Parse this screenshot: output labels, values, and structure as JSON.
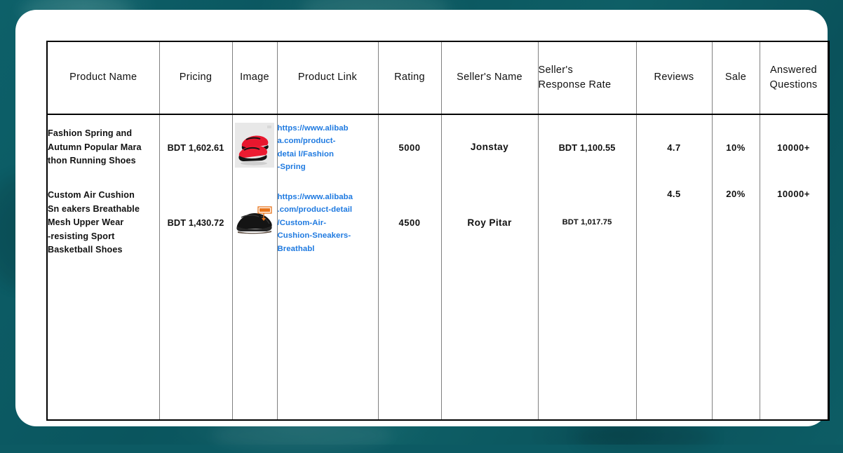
{
  "theme": {
    "background_color": "#0c5a63",
    "card_color": "#ffffff",
    "table_border_color": "#000000",
    "grid_line_color": "#808080",
    "link_color": "#1f7ae0",
    "text_color": "#111111"
  },
  "table": {
    "columns": [
      {
        "key": "product_name",
        "label": "Product Name"
      },
      {
        "key": "pricing",
        "label": "Pricing"
      },
      {
        "key": "image",
        "label": "Image"
      },
      {
        "key": "product_link",
        "label": "Product Link"
      },
      {
        "key": "rating",
        "label": "Rating"
      },
      {
        "key": "sellers_name",
        "label": "Seller's Name"
      },
      {
        "key": "sellers_response_rate",
        "label": "Seller's\nResponse Rate"
      },
      {
        "key": "reviews",
        "label": "Reviews"
      },
      {
        "key": "sale",
        "label": "Sale"
      },
      {
        "key": "answered_questions",
        "label": "Answered\nQuestions"
      }
    ],
    "rows": [
      {
        "product_name": "Fashion Spring and\nAutumn Popular Mara\nthon Running Shoes",
        "pricing": "BDT 1,602.61",
        "image_alt": "red-running-shoes-thumbnail",
        "product_link": "https://www.alibab\na.com/product-\ndetai l/Fashion\n-Spring",
        "rating": "5000",
        "sellers_name": "Jonstay",
        "sellers_response_rate": "BDT 1,100.55",
        "reviews": "4.7",
        "sale": "10%",
        "answered_questions": "10000+"
      },
      {
        "product_name": "Custom Air Cushion\nSn eakers Breathable\nMesh Upper Wear\n-resisting Sport\nBasketball Shoes",
        "pricing": "BDT 1,430.72",
        "image_alt": "black-sneaker-thumbnail",
        "product_link": "https://www.alibaba\n.com/product-detail\n/Custom-Air-\nCushion-Sneakers-\nBreathabl",
        "rating": "4500",
        "sellers_name": "Roy Pitar",
        "sellers_response_rate": "BDT 1,017.75",
        "reviews": "4.5",
        "sale": "20%",
        "answered_questions": "10000+"
      }
    ]
  }
}
